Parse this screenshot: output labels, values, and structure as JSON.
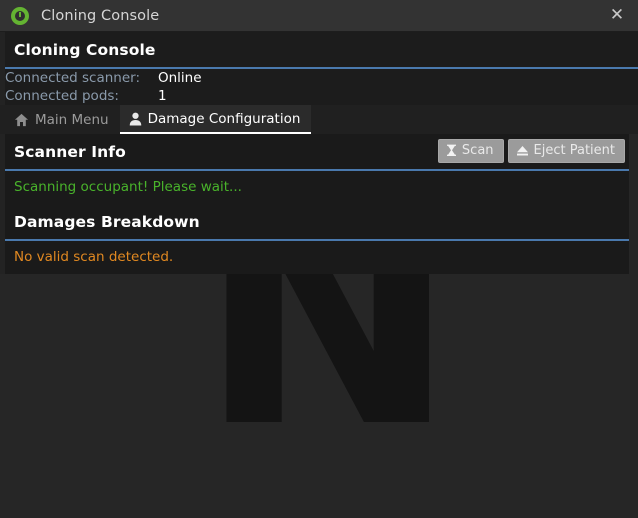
{
  "window": {
    "title": "Cloning Console",
    "icon": "cloning-eye-icon",
    "close_label": "✕",
    "accent_rule_color": "#4a79ad",
    "background_watermark_letter": "N"
  },
  "header": {
    "title": "Cloning Console",
    "stats": [
      {
        "key": "Connected scanner:",
        "value": "Online"
      },
      {
        "key": "Connected pods:",
        "value": "1"
      }
    ]
  },
  "tabs": [
    {
      "id": "main-menu",
      "label": "Main Menu",
      "icon": "home-icon",
      "active": false
    },
    {
      "id": "damage-configuration",
      "label": "Damage Configuration",
      "icon": "person-icon",
      "active": true
    }
  ],
  "scanner_info": {
    "title": "Scanner Info",
    "buttons": [
      {
        "id": "scan",
        "label": "Scan",
        "icon": "hourglass-icon"
      },
      {
        "id": "eject-patient",
        "label": "Eject Patient",
        "icon": "eject-icon"
      }
    ],
    "status_message": "Scanning occupant! Please wait...",
    "status_color": "#49b32b"
  },
  "damages_breakdown": {
    "title": "Damages Breakdown",
    "message": "No valid scan detected.",
    "message_color": "#e08821"
  }
}
